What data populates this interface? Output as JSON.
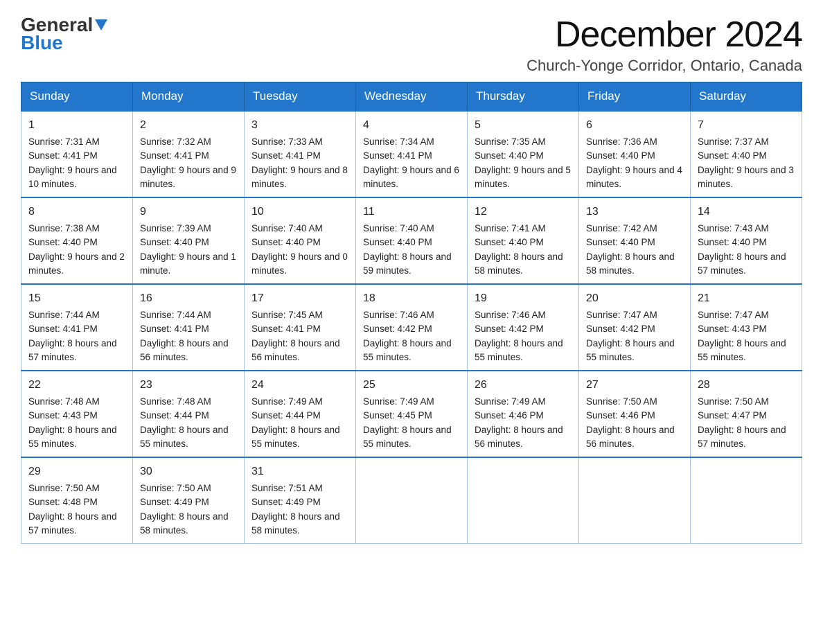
{
  "header": {
    "logo_general": "General",
    "logo_blue": "Blue",
    "month_title": "December 2024",
    "subtitle": "Church-Yonge Corridor, Ontario, Canada"
  },
  "days_of_week": [
    "Sunday",
    "Monday",
    "Tuesday",
    "Wednesday",
    "Thursday",
    "Friday",
    "Saturday"
  ],
  "weeks": [
    [
      {
        "day": "1",
        "sunrise": "7:31 AM",
        "sunset": "4:41 PM",
        "daylight": "9 hours and 10 minutes."
      },
      {
        "day": "2",
        "sunrise": "7:32 AM",
        "sunset": "4:41 PM",
        "daylight": "9 hours and 9 minutes."
      },
      {
        "day": "3",
        "sunrise": "7:33 AM",
        "sunset": "4:41 PM",
        "daylight": "9 hours and 8 minutes."
      },
      {
        "day": "4",
        "sunrise": "7:34 AM",
        "sunset": "4:41 PM",
        "daylight": "9 hours and 6 minutes."
      },
      {
        "day": "5",
        "sunrise": "7:35 AM",
        "sunset": "4:40 PM",
        "daylight": "9 hours and 5 minutes."
      },
      {
        "day": "6",
        "sunrise": "7:36 AM",
        "sunset": "4:40 PM",
        "daylight": "9 hours and 4 minutes."
      },
      {
        "day": "7",
        "sunrise": "7:37 AM",
        "sunset": "4:40 PM",
        "daylight": "9 hours and 3 minutes."
      }
    ],
    [
      {
        "day": "8",
        "sunrise": "7:38 AM",
        "sunset": "4:40 PM",
        "daylight": "9 hours and 2 minutes."
      },
      {
        "day": "9",
        "sunrise": "7:39 AM",
        "sunset": "4:40 PM",
        "daylight": "9 hours and 1 minute."
      },
      {
        "day": "10",
        "sunrise": "7:40 AM",
        "sunset": "4:40 PM",
        "daylight": "9 hours and 0 minutes."
      },
      {
        "day": "11",
        "sunrise": "7:40 AM",
        "sunset": "4:40 PM",
        "daylight": "8 hours and 59 minutes."
      },
      {
        "day": "12",
        "sunrise": "7:41 AM",
        "sunset": "4:40 PM",
        "daylight": "8 hours and 58 minutes."
      },
      {
        "day": "13",
        "sunrise": "7:42 AM",
        "sunset": "4:40 PM",
        "daylight": "8 hours and 58 minutes."
      },
      {
        "day": "14",
        "sunrise": "7:43 AM",
        "sunset": "4:40 PM",
        "daylight": "8 hours and 57 minutes."
      }
    ],
    [
      {
        "day": "15",
        "sunrise": "7:44 AM",
        "sunset": "4:41 PM",
        "daylight": "8 hours and 57 minutes."
      },
      {
        "day": "16",
        "sunrise": "7:44 AM",
        "sunset": "4:41 PM",
        "daylight": "8 hours and 56 minutes."
      },
      {
        "day": "17",
        "sunrise": "7:45 AM",
        "sunset": "4:41 PM",
        "daylight": "8 hours and 56 minutes."
      },
      {
        "day": "18",
        "sunrise": "7:46 AM",
        "sunset": "4:42 PM",
        "daylight": "8 hours and 55 minutes."
      },
      {
        "day": "19",
        "sunrise": "7:46 AM",
        "sunset": "4:42 PM",
        "daylight": "8 hours and 55 minutes."
      },
      {
        "day": "20",
        "sunrise": "7:47 AM",
        "sunset": "4:42 PM",
        "daylight": "8 hours and 55 minutes."
      },
      {
        "day": "21",
        "sunrise": "7:47 AM",
        "sunset": "4:43 PM",
        "daylight": "8 hours and 55 minutes."
      }
    ],
    [
      {
        "day": "22",
        "sunrise": "7:48 AM",
        "sunset": "4:43 PM",
        "daylight": "8 hours and 55 minutes."
      },
      {
        "day": "23",
        "sunrise": "7:48 AM",
        "sunset": "4:44 PM",
        "daylight": "8 hours and 55 minutes."
      },
      {
        "day": "24",
        "sunrise": "7:49 AM",
        "sunset": "4:44 PM",
        "daylight": "8 hours and 55 minutes."
      },
      {
        "day": "25",
        "sunrise": "7:49 AM",
        "sunset": "4:45 PM",
        "daylight": "8 hours and 55 minutes."
      },
      {
        "day": "26",
        "sunrise": "7:49 AM",
        "sunset": "4:46 PM",
        "daylight": "8 hours and 56 minutes."
      },
      {
        "day": "27",
        "sunrise": "7:50 AM",
        "sunset": "4:46 PM",
        "daylight": "8 hours and 56 minutes."
      },
      {
        "day": "28",
        "sunrise": "7:50 AM",
        "sunset": "4:47 PM",
        "daylight": "8 hours and 57 minutes."
      }
    ],
    [
      {
        "day": "29",
        "sunrise": "7:50 AM",
        "sunset": "4:48 PM",
        "daylight": "8 hours and 57 minutes."
      },
      {
        "day": "30",
        "sunrise": "7:50 AM",
        "sunset": "4:49 PM",
        "daylight": "8 hours and 58 minutes."
      },
      {
        "day": "31",
        "sunrise": "7:51 AM",
        "sunset": "4:49 PM",
        "daylight": "8 hours and 58 minutes."
      },
      null,
      null,
      null,
      null
    ]
  ]
}
